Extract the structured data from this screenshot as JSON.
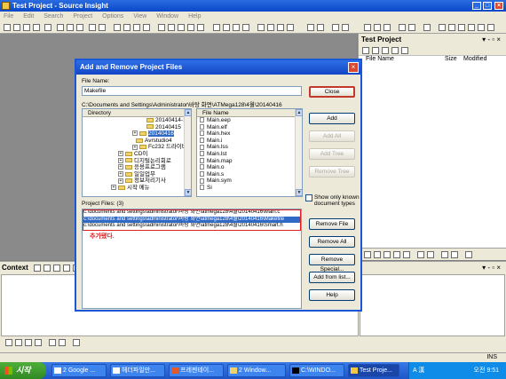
{
  "app": {
    "title": "Test Project - Source Insight",
    "menu": [
      "File",
      "Edit",
      "Search",
      "Project",
      "Options",
      "View",
      "Window",
      "Help"
    ]
  },
  "project_panel": {
    "title": "Test Project",
    "col_name": "File Name",
    "col_size": "Size",
    "col_modified": "Modified"
  },
  "context_panel": {
    "title": "Context"
  },
  "statusbar": {
    "ins": "INS"
  },
  "dialog": {
    "title": "Add and Remove Project Files",
    "file_name_label": "File Name:",
    "file_name_value": "Makefile",
    "path": "C:\\Documents and Settings\\Administrator\\바탕 화면\\ATMega128\\4월\\20140416",
    "directory_header": "Directory",
    "directory_items": [
      {
        "label": "20140414-1",
        "expander": "",
        "selected": false,
        "indent": 64
      },
      {
        "label": "20140415",
        "expander": "",
        "selected": false,
        "indent": 64
      },
      {
        "label": "20140416",
        "expander": "+",
        "selected": true,
        "indent": 56
      },
      {
        "label": "Avrstudio4",
        "expander": "",
        "selected": false,
        "indent": 52
      },
      {
        "label": "Fc232 드라이버",
        "expander": "+",
        "selected": false,
        "indent": 56
      },
      {
        "label": "CD이",
        "expander": "+",
        "selected": false,
        "indent": 40
      },
      {
        "label": "디지털논리회로",
        "expander": "+",
        "selected": false,
        "indent": 40
      },
      {
        "label": "응용프로그램",
        "expander": "+",
        "selected": false,
        "indent": 40
      },
      {
        "label": "일일업무",
        "expander": "+",
        "selected": false,
        "indent": 40
      },
      {
        "label": "정보처리기사",
        "expander": "+",
        "selected": false,
        "indent": 40
      },
      {
        "label": "시작 메뉴",
        "expander": "+",
        "selected": false,
        "indent": 32
      }
    ],
    "file_header": "File Name",
    "files": [
      "Main.eep",
      "Main.elf",
      "Main.hex",
      "Main.i",
      "Main.lss",
      "Main.lst",
      "Main.map",
      "Main.o",
      "Main.s",
      "Main.sym",
      "Si"
    ],
    "buttons": {
      "close": "Close",
      "add": "Add",
      "add_all": "Add All",
      "add_tree": "Add Tree",
      "remove_tree": "Remove Tree",
      "remove_file": "Remove File",
      "remove_all": "Remove All",
      "remove_special": "Remove Special...",
      "add_from_list": "Add from list...",
      "help": "Help"
    },
    "show_only_known": "Show only known document types",
    "project_files_label": "Project Files: (3)",
    "project_files": [
      "c:\\documents and settings\\administrator\\바탕 화면\\atmega128\\4월\\20140416\\Main.c",
      "c:\\documents and settings\\administrator\\바탕 화면\\atmega128\\4월\\20140416\\Makefile",
      "c:\\documents and settings\\administrator\\바탕 화면\\atmega128\\4월\\20140416\\Smart.h"
    ],
    "annotation": "추가됐다."
  },
  "taskbar": {
    "start": "시작",
    "tasks": [
      {
        "label": "2 Google ...",
        "active": false
      },
      {
        "label": "헤더파일만...",
        "active": false
      },
      {
        "label": "프레젠테이...",
        "active": false
      },
      {
        "label": "2 Window...",
        "active": false
      },
      {
        "label": "C:\\WINDO...",
        "active": false
      },
      {
        "label": "Test Proje...",
        "active": true
      }
    ],
    "tray_lang": "A 漢",
    "clock": "오전 9:51"
  },
  "colors": {
    "titlebar": "#0a48c8",
    "selection": "#316ac5",
    "annotation_red": "#e02020",
    "taskbar": "#1e55c8"
  }
}
